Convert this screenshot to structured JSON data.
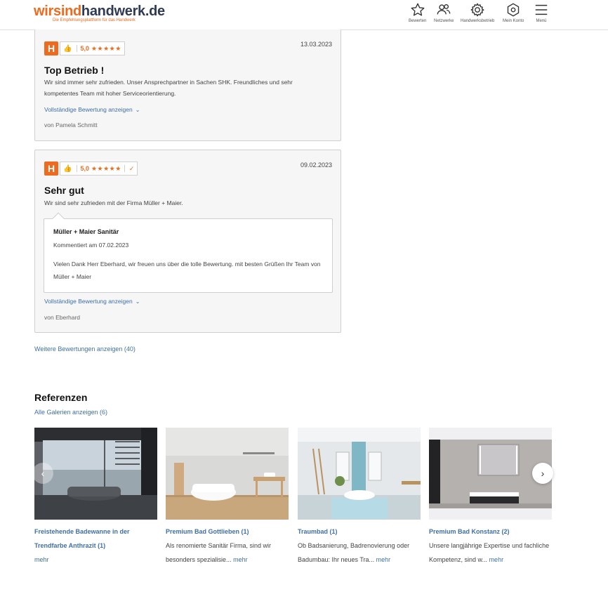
{
  "header": {
    "logo_part1": "wir",
    "logo_part2": "sind",
    "logo_part3": "handwerk.de",
    "tagline": "Die Empfehlungsplattform für das Handwerk",
    "nav": [
      {
        "label": "Bewerten",
        "icon": "star-icon"
      },
      {
        "label": "Netzwerke",
        "icon": "users-icon"
      },
      {
        "label": "Handwerksbetrieb",
        "icon": "gear-icon"
      },
      {
        "label": "Mein Konto",
        "icon": "hexagon-icon"
      },
      {
        "label": "Menü",
        "icon": "hamburger-icon"
      }
    ]
  },
  "brand_color": "#ee6a1e",
  "link_color": "#3f6fa8",
  "reviews": [
    {
      "badge": "H",
      "rating": "5,0",
      "stars": "★★★★★",
      "date": "13.03.2023",
      "title": "Top Betrieb !",
      "text": "Wir sind immer sehr zufrieden. Unser Ansprechpartner in Sachen SHK. Freundliches und sehr kompetentes Team mit hoher Serviceorientierung.",
      "link": "Vollständige Bewertung anzeigen",
      "author": "von Pamela Schmitt"
    },
    {
      "badge": "H",
      "rating": "5,0",
      "stars": "★★★★★",
      "verified": "✓",
      "date": "09.02.2023",
      "title": "Sehr gut",
      "text": "Wir sind sehr zufrieden mit der Firma Müller + Maier.",
      "reply": {
        "name": "Müller + Maier Sanitär",
        "date": "Kommentiert am 07.02.2023",
        "text": "Vielen Dank Herr Eberhard, wir freuen uns über die tolle Bewertung. mit besten Grüßen Ihr Team von Müller + Maier"
      },
      "link": "Vollständige Bewertung anzeigen",
      "author": "von Eberhard"
    }
  ],
  "more_reviews": "Weitere Bewertungen anzeigen (40)",
  "references": {
    "title": "Referenzen",
    "all_link": "Alle Galerien anzeigen (6)",
    "items": [
      {
        "title": "Freistehende Badewanne in der Trendfarbe Anthrazit (1)",
        "desc": "",
        "more": "mehr"
      },
      {
        "title": "Premium Bad Gottlieben (1)",
        "desc": "Als renomierte Sanitär Firma, sind wir besonders spezialisie...",
        "more": "mehr"
      },
      {
        "title": "Traumbad (1)",
        "desc": "Ob Badsanierung, Badrenovierung oder Badumbau: Ihr neues Tra...",
        "more": "mehr"
      },
      {
        "title": "Premium Bad Konstanz (2)",
        "desc": "Unsere langjährige Expertise und fachliche Kompetenz, sind w...",
        "more": "mehr"
      }
    ]
  }
}
